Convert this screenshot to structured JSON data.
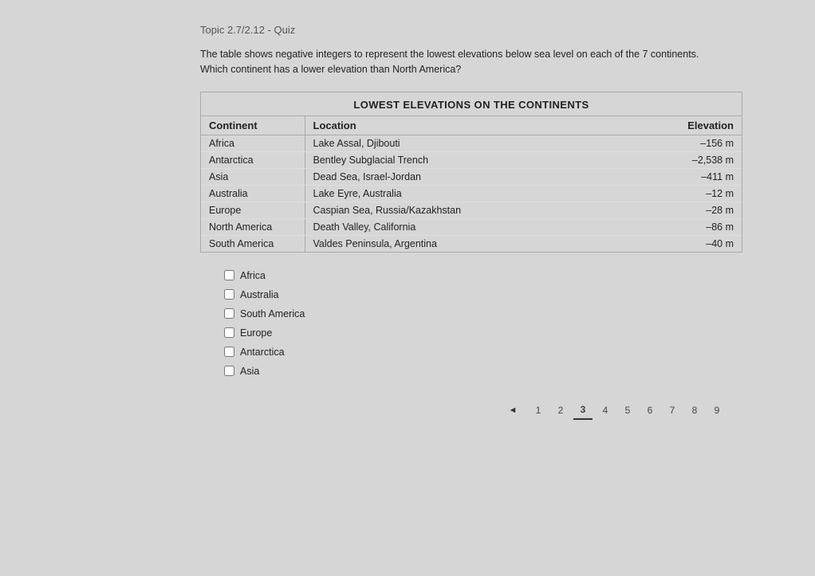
{
  "topic": {
    "title": "Topic 2.7/2.12 - Quiz"
  },
  "instructions": {
    "line1": "The table shows negative integers to represent the lowest elevations below sea level on each of the 7 continents.",
    "line2": "Which continent has a lower elevation than North America?"
  },
  "table": {
    "title": "LOWEST ELEVATIONS ON THE CONTINENTS",
    "columns": [
      "Continent",
      "Location",
      "Elevation"
    ],
    "rows": [
      {
        "continent": "Africa",
        "location": "Lake Assal, Djibouti",
        "elevation": "–156 m"
      },
      {
        "continent": "Antarctica",
        "location": "Bentley Subglacial Trench",
        "elevation": "–2,538 m"
      },
      {
        "continent": "Asia",
        "location": "Dead Sea, Israel-Jordan",
        "elevation": "–411 m"
      },
      {
        "continent": "Australia",
        "location": "Lake Eyre, Australia",
        "elevation": "–12 m"
      },
      {
        "continent": "Europe",
        "location": "Caspian Sea, Russia/Kazakhstan",
        "elevation": "–28 m"
      },
      {
        "continent": "North America",
        "location": "Death Valley, California",
        "elevation": "–86 m"
      },
      {
        "continent": "South America",
        "location": "Valdes Peninsula, Argentina",
        "elevation": "–40 m"
      }
    ]
  },
  "options": [
    {
      "id": "opt1",
      "label": "Africa"
    },
    {
      "id": "opt2",
      "label": "Australia"
    },
    {
      "id": "opt3",
      "label": "South America"
    },
    {
      "id": "opt4",
      "label": "Europe"
    },
    {
      "id": "opt5",
      "label": "Antarctica"
    },
    {
      "id": "opt6",
      "label": "Asia"
    }
  ],
  "pagination": {
    "prev_label": "◄",
    "pages": [
      "1",
      "2",
      "3",
      "4",
      "5",
      "6",
      "7",
      "8",
      "9"
    ],
    "active_page": "3"
  }
}
